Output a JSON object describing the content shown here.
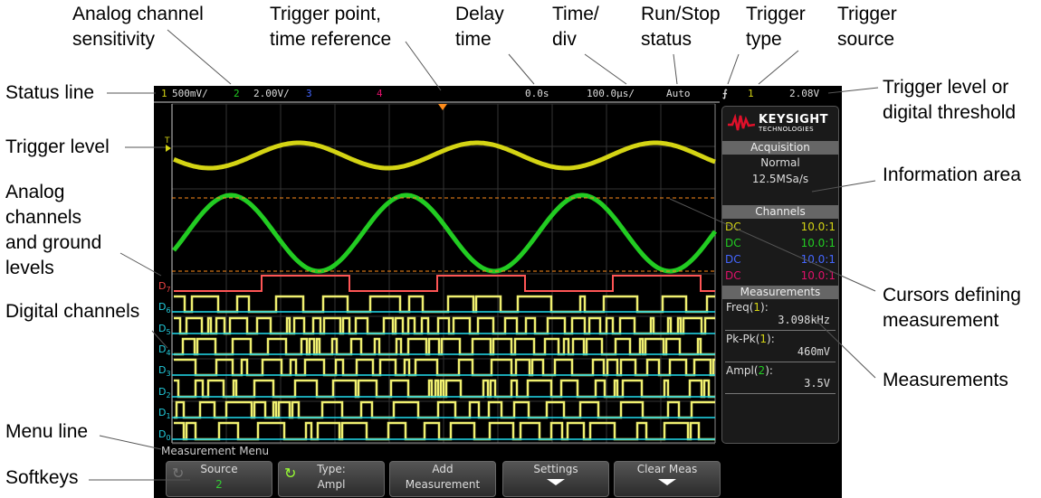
{
  "annotations": {
    "analog_channel_sensitivity": "Analog channel\nsensitivity",
    "trigger_point": "Trigger point,\ntime reference",
    "delay_time": "Delay\ntime",
    "time_div": "Time/\ndiv",
    "run_stop": "Run/Stop\nstatus",
    "trigger_type": "Trigger\ntype",
    "trigger_source": "Trigger\nsource",
    "status_line": "Status line",
    "trigger_level": "Trigger level",
    "analog_channels": "Analog\nchannels\nand ground\nlevels",
    "digital_channels": "Digital channels",
    "menu_line": "Menu line",
    "softkeys": "Softkeys",
    "trigger_level_threshold": "Trigger level or\ndigital threshold",
    "information_area": "Information area",
    "cursors": "Cursors defining\nmeasurement",
    "measurements": "Measurements"
  },
  "status": {
    "ch1": "1",
    "ch1_scale": "500mV/",
    "ch2": "2",
    "ch2_scale": "2.00V/",
    "ch3": "3",
    "ch4": "4",
    "delay": "0.0s",
    "timebase": "100.0µs/",
    "run_state": "Auto",
    "trigger_type_icon": "rising-edge-icon",
    "trigger_source": "1",
    "trigger_level": "2.08V"
  },
  "colors": {
    "ch1": "#d4d414",
    "ch2": "#22cc22",
    "ch3": "#4466ff",
    "ch4": "#e0106a",
    "digital_high": "#f0f070",
    "digital_low": "#20d0e0",
    "cursor": "#ff8c1a",
    "brand": "#e0102a"
  },
  "panel": {
    "brand": "KEYSIGHT",
    "brand_sub": "TECHNOLOGIES",
    "acquisition": {
      "title": "Acquisition",
      "mode": "Normal",
      "rate": "12.5MSa/s"
    },
    "channels": {
      "title": "Channels",
      "rows": [
        {
          "coupling": "DC",
          "probe": "10.0:1"
        },
        {
          "coupling": "DC",
          "probe": "10.0:1"
        },
        {
          "coupling": "DC",
          "probe": "10.0:1"
        },
        {
          "coupling": "DC",
          "probe": "10.0:1"
        }
      ]
    },
    "measurements": {
      "title": "Measurements",
      "items": [
        {
          "name": "Freq",
          "src": "1",
          "value": "3.098kHz"
        },
        {
          "name": "Pk-Pk",
          "src": "1",
          "value": "460mV"
        },
        {
          "name": "Ampl",
          "src": "2",
          "value": "3.5V"
        }
      ]
    }
  },
  "digital_labels": [
    "D7",
    "D6",
    "D5",
    "D4",
    "D3",
    "D2",
    "D1",
    "D0"
  ],
  "menu": {
    "title": "Measurement Menu",
    "softkeys": [
      {
        "line1": "Source",
        "line2": "2"
      },
      {
        "line1": "Type:",
        "line2": "Ampl"
      },
      {
        "line1": "Add",
        "line2": "Measurement"
      },
      {
        "line1": "Settings",
        "line2": ""
      },
      {
        "line1": "Clear Meas",
        "line2": ""
      }
    ]
  }
}
